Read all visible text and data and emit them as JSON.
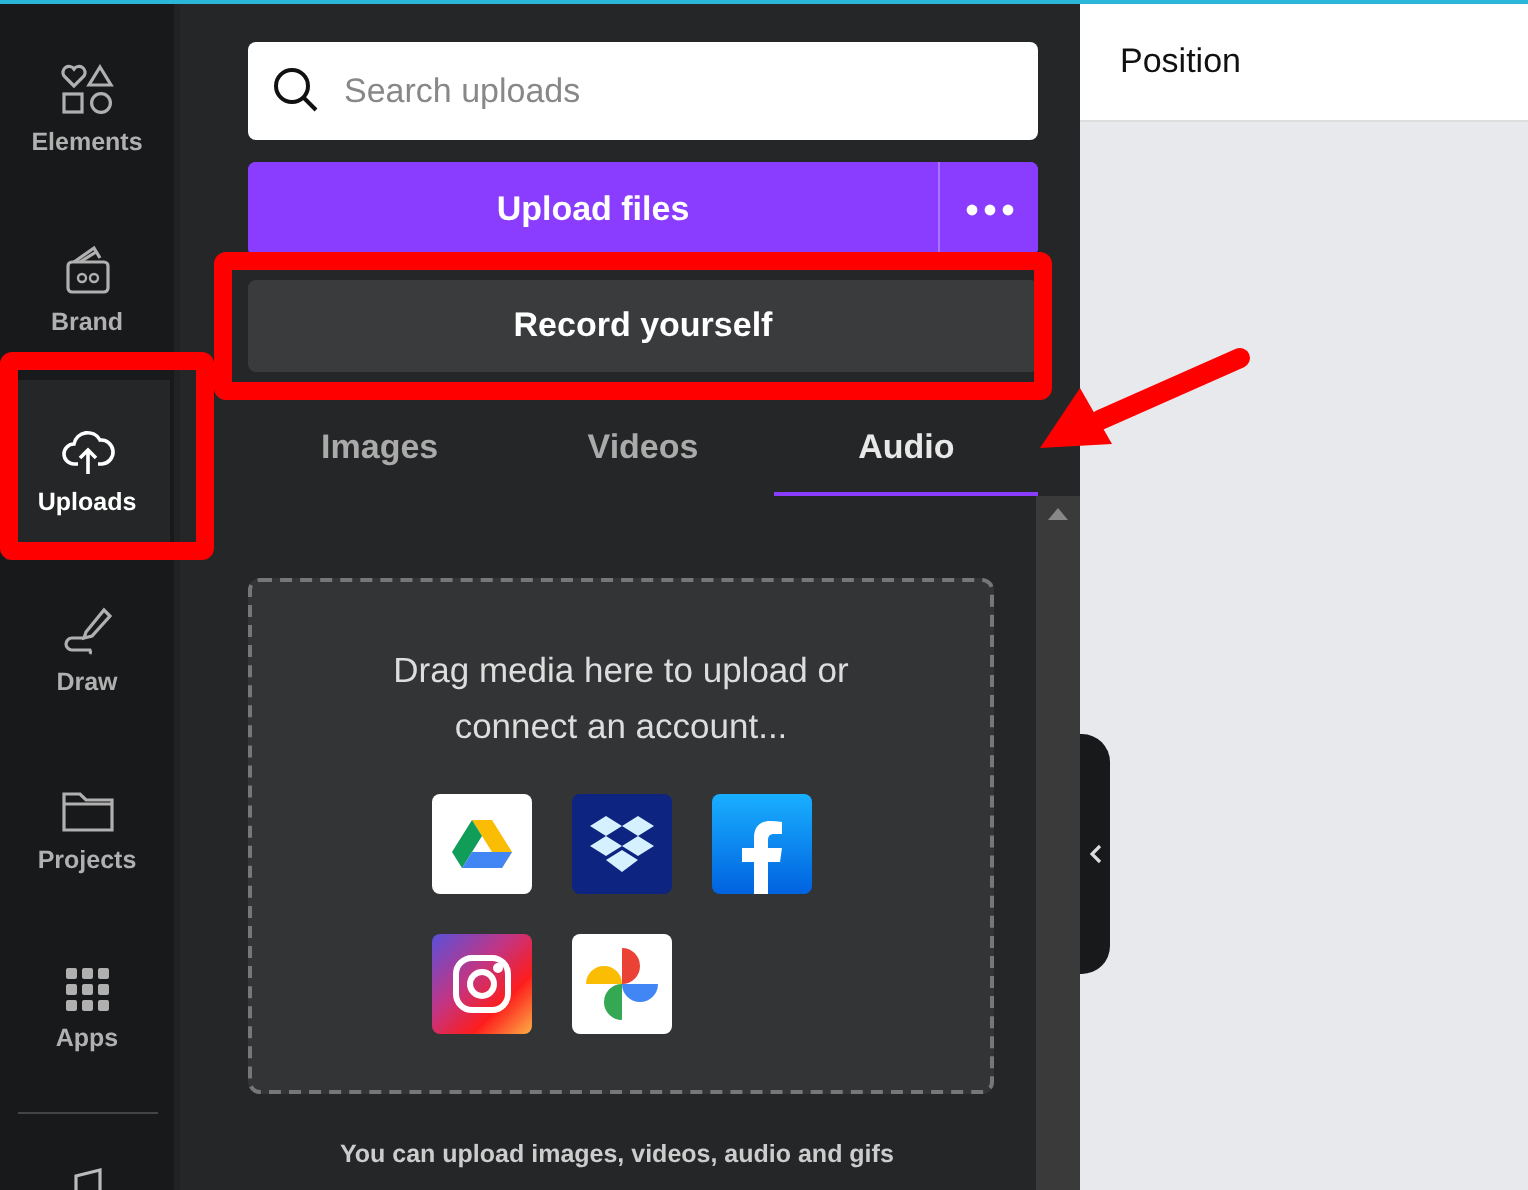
{
  "rail": {
    "items": [
      {
        "label": "Elements",
        "kind": "elements",
        "selected": false
      },
      {
        "label": "Brand",
        "kind": "brand",
        "selected": false
      },
      {
        "label": "Uploads",
        "kind": "uploads",
        "selected": true
      },
      {
        "label": "Draw",
        "kind": "draw",
        "selected": false
      },
      {
        "label": "Projects",
        "kind": "projects",
        "selected": false
      },
      {
        "label": "Apps",
        "kind": "apps",
        "selected": false
      }
    ]
  },
  "panel": {
    "search": {
      "placeholder": "Search uploads"
    },
    "upload_button": "Upload files",
    "record_button": "Record yourself",
    "tabs": [
      {
        "label": "Images",
        "selected": false
      },
      {
        "label": "Videos",
        "selected": false
      },
      {
        "label": "Audio",
        "selected": true
      }
    ],
    "dropzone": {
      "text": "Drag media here to upload or connect an account...",
      "sources": [
        {
          "kind": "drive"
        },
        {
          "kind": "dropbox"
        },
        {
          "kind": "facebook"
        },
        {
          "kind": "instagram"
        },
        {
          "kind": "photos"
        }
      ]
    },
    "note": "You can upload images, videos, audio and gifs"
  },
  "toolbar": {
    "title": "Position"
  }
}
